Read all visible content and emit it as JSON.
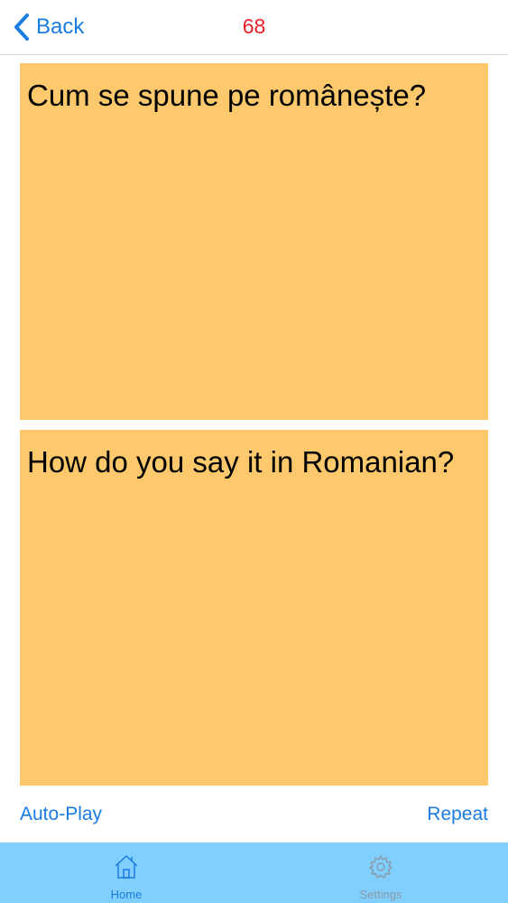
{
  "nav": {
    "back_label": "Back",
    "count": "68"
  },
  "cards": {
    "top_text": "Cum se spune pe românește?",
    "bottom_text": "How do you say it in Romanian?"
  },
  "controls": {
    "auto_play_label": "Auto-Play",
    "repeat_label": "Repeat"
  },
  "tabbar": {
    "tabs": [
      {
        "label": "Home",
        "icon": "home-icon",
        "selected": true
      },
      {
        "label": "Settings",
        "icon": "gear-icon",
        "selected": false
      }
    ]
  },
  "colors": {
    "accent": "#1a7be0",
    "count": "#e8202a",
    "card_background": "#fec96c",
    "tabbar_background": "#80cfff",
    "inactive_tab": "#8a9aa5"
  }
}
